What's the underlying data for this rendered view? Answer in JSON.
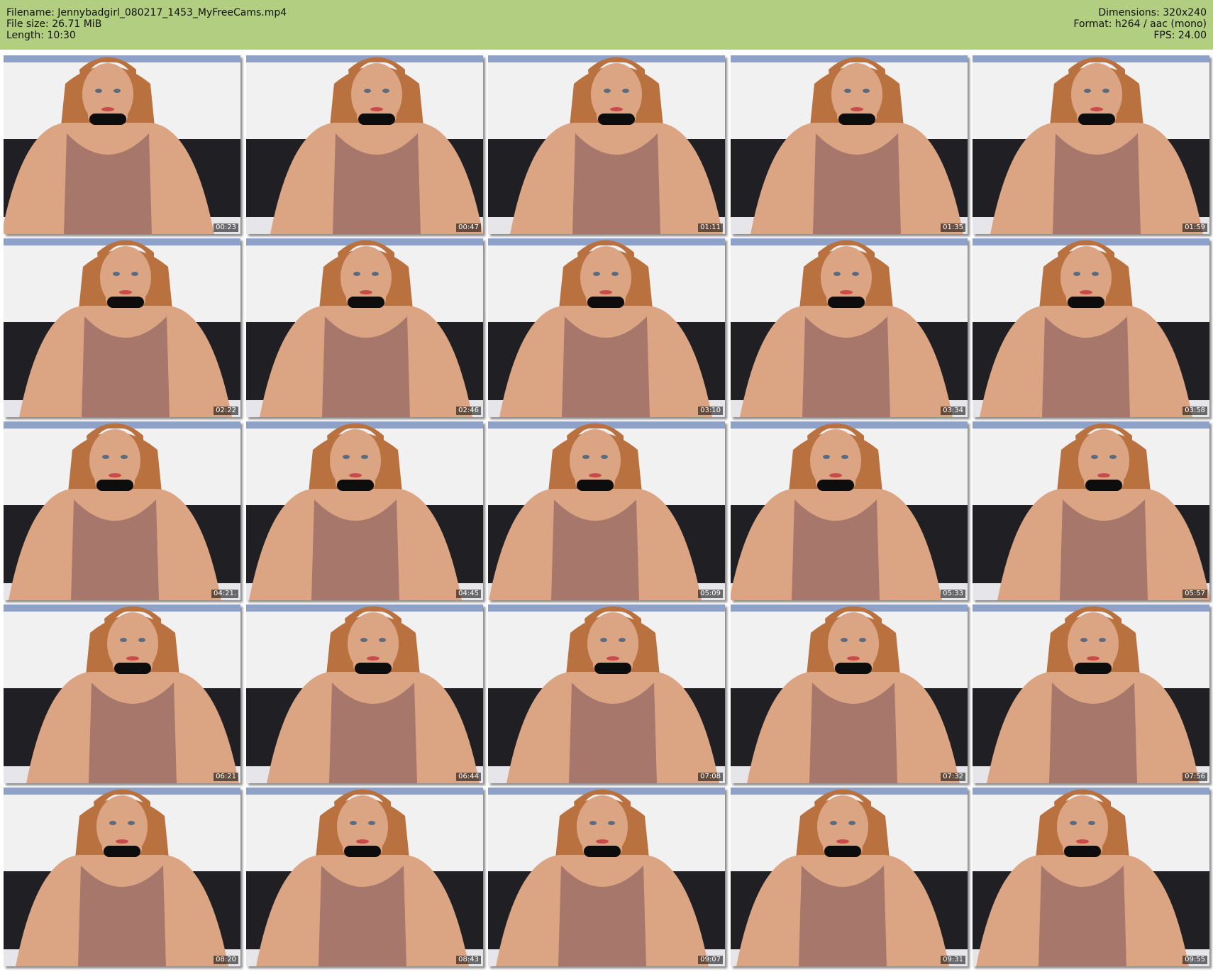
{
  "header": {
    "filename_label": "Filename: Jennybadgirl_080217_1453_MyFreeCams.mp4",
    "filesize_label": "File size: 26.71 MiB",
    "length_label": "Length: 10:30",
    "dimensions_label": "Dimensions: 320x240",
    "format_label": "Format: h264 / aac (mono)",
    "fps_label": "FPS: 24.00"
  },
  "colors": {
    "header_bg": "#b2ce80",
    "wall": "#f1f1f1",
    "couch": "#1f1f24",
    "skin": "#dba583",
    "top": "#a7776c",
    "hair": "#b9723f",
    "choker": "#0d0d0d"
  },
  "thumbnails": [
    {
      "time": "00:23"
    },
    {
      "time": "00:47"
    },
    {
      "time": "01:11"
    },
    {
      "time": "01:35"
    },
    {
      "time": "01:59"
    },
    {
      "time": "02:22"
    },
    {
      "time": "02:46"
    },
    {
      "time": "03:10"
    },
    {
      "time": "03:34"
    },
    {
      "time": "03:58"
    },
    {
      "time": "04:21."
    },
    {
      "time": "04:45"
    },
    {
      "time": "05:09"
    },
    {
      "time": "05:33"
    },
    {
      "time": "05:57"
    },
    {
      "time": "06:21"
    },
    {
      "time": "06:44"
    },
    {
      "time": "07:08"
    },
    {
      "time": "07:32"
    },
    {
      "time": "07:56"
    },
    {
      "time": "08:20"
    },
    {
      "time": "08:43"
    },
    {
      "time": "09:07"
    },
    {
      "time": "09:31"
    },
    {
      "time": "09:55"
    }
  ]
}
